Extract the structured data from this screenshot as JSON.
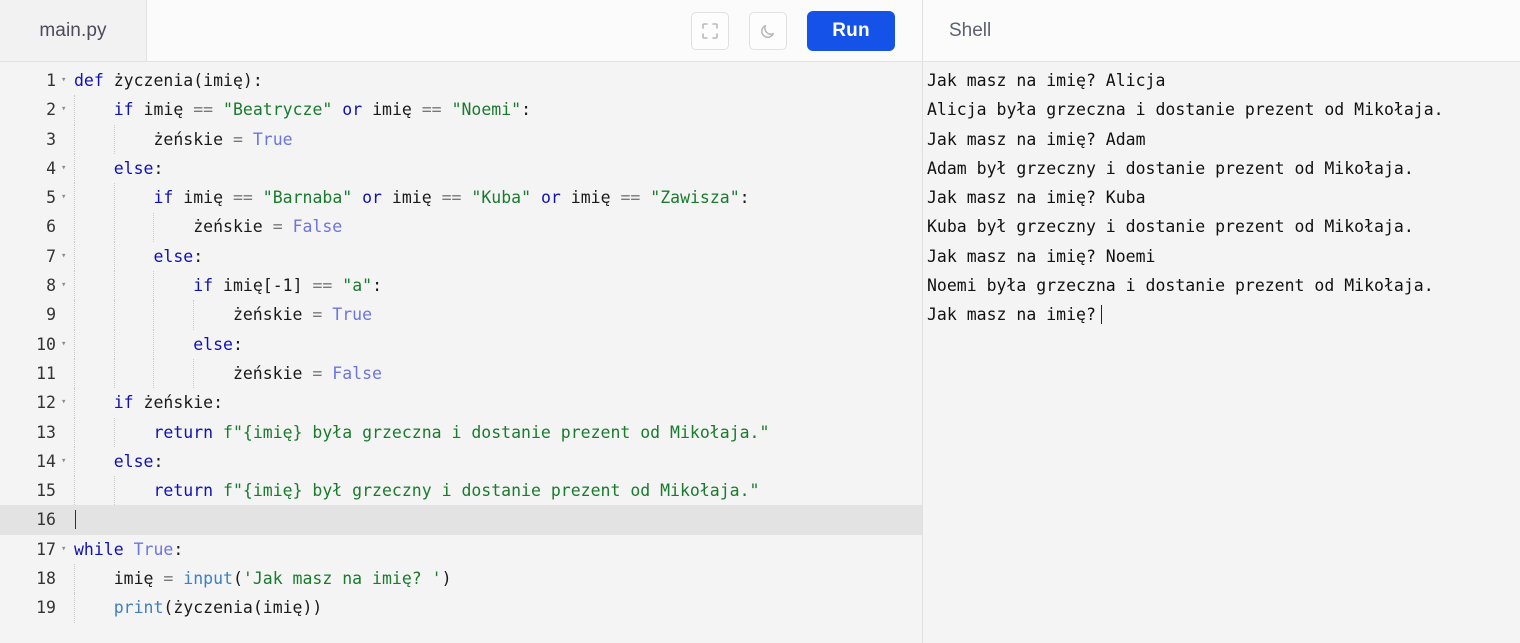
{
  "editor": {
    "tab_label": "main.py",
    "toolbar": {
      "fullscreen_icon": "fullscreen-icon",
      "theme_icon": "moon-icon",
      "run_label": "Run",
      "run_color": "#1552e8"
    },
    "active_line": 16,
    "lines": [
      {
        "n": "1",
        "fold": "▾",
        "tokens": [
          {
            "t": "def",
            "c": "kw"
          },
          {
            "t": " życzenia(imię):",
            "c": "pn"
          }
        ]
      },
      {
        "n": "2",
        "fold": "▾",
        "tokens": [
          {
            "t": "    ",
            "c": "pn"
          },
          {
            "t": "if",
            "c": "kw"
          },
          {
            "t": " imię ",
            "c": "pn"
          },
          {
            "t": "==",
            "c": "op"
          },
          {
            "t": " ",
            "c": "pn"
          },
          {
            "t": "\"Beatrycze\"",
            "c": "str"
          },
          {
            "t": " ",
            "c": "pn"
          },
          {
            "t": "or",
            "c": "kw"
          },
          {
            "t": " imię ",
            "c": "pn"
          },
          {
            "t": "==",
            "c": "op"
          },
          {
            "t": " ",
            "c": "pn"
          },
          {
            "t": "\"Noemi\"",
            "c": "str"
          },
          {
            "t": ":",
            "c": "pn"
          }
        ]
      },
      {
        "n": "3",
        "fold": "",
        "tokens": [
          {
            "t": "        żeńskie ",
            "c": "pn"
          },
          {
            "t": "=",
            "c": "op"
          },
          {
            "t": " ",
            "c": "pn"
          },
          {
            "t": "True",
            "c": "bool"
          }
        ]
      },
      {
        "n": "4",
        "fold": "▾",
        "tokens": [
          {
            "t": "    ",
            "c": "pn"
          },
          {
            "t": "else",
            "c": "kw"
          },
          {
            "t": ":",
            "c": "pn"
          }
        ]
      },
      {
        "n": "5",
        "fold": "▾",
        "tokens": [
          {
            "t": "        ",
            "c": "pn"
          },
          {
            "t": "if",
            "c": "kw"
          },
          {
            "t": " imię ",
            "c": "pn"
          },
          {
            "t": "==",
            "c": "op"
          },
          {
            "t": " ",
            "c": "pn"
          },
          {
            "t": "\"Barnaba\"",
            "c": "str"
          },
          {
            "t": " ",
            "c": "pn"
          },
          {
            "t": "or",
            "c": "kw"
          },
          {
            "t": " imię ",
            "c": "pn"
          },
          {
            "t": "==",
            "c": "op"
          },
          {
            "t": " ",
            "c": "pn"
          },
          {
            "t": "\"Kuba\"",
            "c": "str"
          },
          {
            "t": " ",
            "c": "pn"
          },
          {
            "t": "or",
            "c": "kw"
          },
          {
            "t": " imię ",
            "c": "pn"
          },
          {
            "t": "==",
            "c": "op"
          },
          {
            "t": " ",
            "c": "pn"
          },
          {
            "t": "\"Zawisza\"",
            "c": "str"
          },
          {
            "t": ":",
            "c": "pn"
          }
        ]
      },
      {
        "n": "6",
        "fold": "",
        "tokens": [
          {
            "t": "            żeńskie ",
            "c": "pn"
          },
          {
            "t": "=",
            "c": "op"
          },
          {
            "t": " ",
            "c": "pn"
          },
          {
            "t": "False",
            "c": "bool"
          }
        ]
      },
      {
        "n": "7",
        "fold": "▾",
        "tokens": [
          {
            "t": "        ",
            "c": "pn"
          },
          {
            "t": "else",
            "c": "kw"
          },
          {
            "t": ":",
            "c": "pn"
          }
        ]
      },
      {
        "n": "8",
        "fold": "▾",
        "tokens": [
          {
            "t": "            ",
            "c": "pn"
          },
          {
            "t": "if",
            "c": "kw"
          },
          {
            "t": " imię[",
            "c": "pn"
          },
          {
            "t": "-1",
            "c": "num"
          },
          {
            "t": "] ",
            "c": "pn"
          },
          {
            "t": "==",
            "c": "op"
          },
          {
            "t": " ",
            "c": "pn"
          },
          {
            "t": "\"a\"",
            "c": "str"
          },
          {
            "t": ":",
            "c": "pn"
          }
        ]
      },
      {
        "n": "9",
        "fold": "",
        "tokens": [
          {
            "t": "                żeńskie ",
            "c": "pn"
          },
          {
            "t": "=",
            "c": "op"
          },
          {
            "t": " ",
            "c": "pn"
          },
          {
            "t": "True",
            "c": "bool"
          }
        ]
      },
      {
        "n": "10",
        "fold": "▾",
        "tokens": [
          {
            "t": "            ",
            "c": "pn"
          },
          {
            "t": "else",
            "c": "kw"
          },
          {
            "t": ":",
            "c": "pn"
          }
        ]
      },
      {
        "n": "11",
        "fold": "",
        "tokens": [
          {
            "t": "                żeńskie ",
            "c": "pn"
          },
          {
            "t": "=",
            "c": "op"
          },
          {
            "t": " ",
            "c": "pn"
          },
          {
            "t": "False",
            "c": "bool"
          }
        ]
      },
      {
        "n": "12",
        "fold": "▾",
        "tokens": [
          {
            "t": "    ",
            "c": "pn"
          },
          {
            "t": "if",
            "c": "kw"
          },
          {
            "t": " żeńskie:",
            "c": "pn"
          }
        ]
      },
      {
        "n": "13",
        "fold": "",
        "tokens": [
          {
            "t": "        ",
            "c": "pn"
          },
          {
            "t": "return",
            "c": "kw"
          },
          {
            "t": " ",
            "c": "pn"
          },
          {
            "t": "f\"{imię} była grzeczna i dostanie prezent od Mikołaja.\"",
            "c": "str"
          }
        ]
      },
      {
        "n": "14",
        "fold": "▾",
        "tokens": [
          {
            "t": "    ",
            "c": "pn"
          },
          {
            "t": "else",
            "c": "kw"
          },
          {
            "t": ":",
            "c": "pn"
          }
        ]
      },
      {
        "n": "15",
        "fold": "",
        "tokens": [
          {
            "t": "        ",
            "c": "pn"
          },
          {
            "t": "return",
            "c": "kw"
          },
          {
            "t": " ",
            "c": "pn"
          },
          {
            "t": "f\"{imię} był grzeczny i dostanie prezent od Mikołaja.\"",
            "c": "str"
          }
        ]
      },
      {
        "n": "16",
        "fold": "",
        "tokens": []
      },
      {
        "n": "17",
        "fold": "▾",
        "tokens": [
          {
            "t": "while",
            "c": "kw"
          },
          {
            "t": " ",
            "c": "pn"
          },
          {
            "t": "True",
            "c": "bool"
          },
          {
            "t": ":",
            "c": "pn"
          }
        ]
      },
      {
        "n": "18",
        "fold": "",
        "tokens": [
          {
            "t": "    imię ",
            "c": "pn"
          },
          {
            "t": "=",
            "c": "op"
          },
          {
            "t": " ",
            "c": "pn"
          },
          {
            "t": "input",
            "c": "fn"
          },
          {
            "t": "(",
            "c": "pn"
          },
          {
            "t": "'Jak masz na imię? '",
            "c": "str"
          },
          {
            "t": ")",
            "c": "pn"
          }
        ]
      },
      {
        "n": "19",
        "fold": "",
        "tokens": [
          {
            "t": "    ",
            "c": "pn"
          },
          {
            "t": "print",
            "c": "fn"
          },
          {
            "t": "(życzenia(imię))",
            "c": "pn"
          }
        ]
      }
    ]
  },
  "shell": {
    "title": "Shell",
    "lines": [
      "Jak masz na imię? Alicja",
      "Alicja była grzeczna i dostanie prezent od Mikołaja.",
      "Jak masz na imię? Adam",
      "Adam był grzeczny i dostanie prezent od Mikołaja.",
      "Jak masz na imię? Kuba",
      "Kuba był grzeczny i dostanie prezent od Mikołaja.",
      "Jak masz na imię? Noemi",
      "Noemi była grzeczna i dostanie prezent od Mikołaja.",
      "Jak masz na imię?"
    ],
    "prompt_waiting": true
  }
}
